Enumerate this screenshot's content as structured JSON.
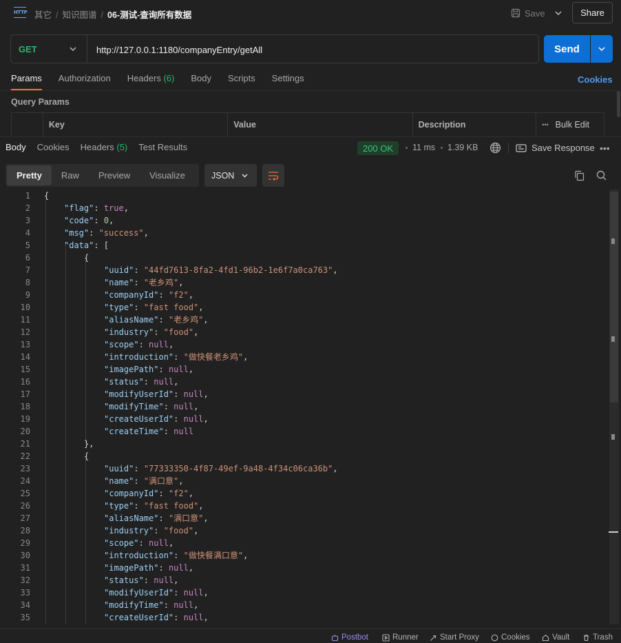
{
  "header": {
    "crumbs": [
      "其它",
      "知识图谱"
    ],
    "current": "06-测试-查询所有数据",
    "save_label": "Save",
    "share_label": "Share",
    "http_icon_label": "HTTP"
  },
  "request": {
    "method": "GET",
    "url": "http://127.0.0.1:1180/companyEntry/getAll",
    "send_label": "Send",
    "tabs": [
      {
        "label": "Params",
        "active": true
      },
      {
        "label": "Authorization"
      },
      {
        "label": "Headers",
        "count": "(6)"
      },
      {
        "label": "Body"
      },
      {
        "label": "Scripts"
      },
      {
        "label": "Settings"
      }
    ],
    "cookies_label": "Cookies",
    "query_params_title": "Query Params",
    "table_headers": [
      "Key",
      "Value",
      "Description"
    ],
    "bulk_edit_label": "Bulk Edit",
    "more_glyph": "•••"
  },
  "response": {
    "tabs": [
      {
        "label": "Body",
        "active": true
      },
      {
        "label": "Cookies"
      },
      {
        "label": "Headers",
        "count": "(5)"
      },
      {
        "label": "Test Results"
      }
    ],
    "status": "200 OK",
    "time": "11 ms",
    "size": "1.39 KB",
    "save_response_label": "Save Response",
    "more_glyph": "•••",
    "view_modes": [
      "Pretty",
      "Raw",
      "Preview",
      "Visualize"
    ],
    "active_view": "Pretty",
    "format": "JSON"
  },
  "code_lines": [
    {
      "n": "1",
      "i": 0,
      "t": [
        [
          "p",
          "{"
        ]
      ]
    },
    {
      "n": "2",
      "i": 1,
      "t": [
        [
          "k",
          "\"flag\""
        ],
        [
          "p",
          ": "
        ],
        [
          "b",
          "true"
        ],
        [
          "p",
          ","
        ]
      ]
    },
    {
      "n": "3",
      "i": 1,
      "t": [
        [
          "k",
          "\"code\""
        ],
        [
          "p",
          ": "
        ],
        [
          "n",
          "0"
        ],
        [
          "p",
          ","
        ]
      ]
    },
    {
      "n": "4",
      "i": 1,
      "t": [
        [
          "k",
          "\"msg\""
        ],
        [
          "p",
          ": "
        ],
        [
          "s",
          "\"success\""
        ],
        [
          "p",
          ","
        ]
      ]
    },
    {
      "n": "5",
      "i": 1,
      "t": [
        [
          "k",
          "\"data\""
        ],
        [
          "p",
          ": ["
        ]
      ]
    },
    {
      "n": "6",
      "i": 2,
      "t": [
        [
          "p",
          "{"
        ]
      ]
    },
    {
      "n": "7",
      "i": 3,
      "t": [
        [
          "k",
          "\"uuid\""
        ],
        [
          "p",
          ": "
        ],
        [
          "s",
          "\"44fd7613-8fa2-4fd1-96b2-1e6f7a0ca763\""
        ],
        [
          "p",
          ","
        ]
      ]
    },
    {
      "n": "8",
      "i": 3,
      "t": [
        [
          "k",
          "\"name\""
        ],
        [
          "p",
          ": "
        ],
        [
          "s",
          "\"老乡鸡\""
        ],
        [
          "p",
          ","
        ]
      ]
    },
    {
      "n": "9",
      "i": 3,
      "t": [
        [
          "k",
          "\"companyId\""
        ],
        [
          "p",
          ": "
        ],
        [
          "s",
          "\"f2\""
        ],
        [
          "p",
          ","
        ]
      ]
    },
    {
      "n": "10",
      "i": 3,
      "t": [
        [
          "k",
          "\"type\""
        ],
        [
          "p",
          ": "
        ],
        [
          "s",
          "\"fast food\""
        ],
        [
          "p",
          ","
        ]
      ]
    },
    {
      "n": "11",
      "i": 3,
      "t": [
        [
          "k",
          "\"aliasName\""
        ],
        [
          "p",
          ": "
        ],
        [
          "s",
          "\"老乡鸡\""
        ],
        [
          "p",
          ","
        ]
      ]
    },
    {
      "n": "12",
      "i": 3,
      "t": [
        [
          "k",
          "\"industry\""
        ],
        [
          "p",
          ": "
        ],
        [
          "s",
          "\"food\""
        ],
        [
          "p",
          ","
        ]
      ]
    },
    {
      "n": "13",
      "i": 3,
      "t": [
        [
          "k",
          "\"scope\""
        ],
        [
          "p",
          ": "
        ],
        [
          "nl",
          "null"
        ],
        [
          "p",
          ","
        ]
      ]
    },
    {
      "n": "14",
      "i": 3,
      "t": [
        [
          "k",
          "\"introduction\""
        ],
        [
          "p",
          ": "
        ],
        [
          "s",
          "\"做快餐老乡鸡\""
        ],
        [
          "p",
          ","
        ]
      ]
    },
    {
      "n": "15",
      "i": 3,
      "t": [
        [
          "k",
          "\"imagePath\""
        ],
        [
          "p",
          ": "
        ],
        [
          "nl",
          "null"
        ],
        [
          "p",
          ","
        ]
      ]
    },
    {
      "n": "16",
      "i": 3,
      "t": [
        [
          "k",
          "\"status\""
        ],
        [
          "p",
          ": "
        ],
        [
          "nl",
          "null"
        ],
        [
          "p",
          ","
        ]
      ]
    },
    {
      "n": "17",
      "i": 3,
      "t": [
        [
          "k",
          "\"modifyUserId\""
        ],
        [
          "p",
          ": "
        ],
        [
          "nl",
          "null"
        ],
        [
          "p",
          ","
        ]
      ]
    },
    {
      "n": "18",
      "i": 3,
      "t": [
        [
          "k",
          "\"modifyTime\""
        ],
        [
          "p",
          ": "
        ],
        [
          "nl",
          "null"
        ],
        [
          "p",
          ","
        ]
      ]
    },
    {
      "n": "19",
      "i": 3,
      "t": [
        [
          "k",
          "\"createUserId\""
        ],
        [
          "p",
          ": "
        ],
        [
          "nl",
          "null"
        ],
        [
          "p",
          ","
        ]
      ]
    },
    {
      "n": "20",
      "i": 3,
      "t": [
        [
          "k",
          "\"createTime\""
        ],
        [
          "p",
          ": "
        ],
        [
          "nl",
          "null"
        ]
      ]
    },
    {
      "n": "21",
      "i": 2,
      "t": [
        [
          "p",
          "},"
        ]
      ]
    },
    {
      "n": "22",
      "i": 2,
      "t": [
        [
          "p",
          "{"
        ]
      ]
    },
    {
      "n": "23",
      "i": 3,
      "t": [
        [
          "k",
          "\"uuid\""
        ],
        [
          "p",
          ": "
        ],
        [
          "s",
          "\"77333350-4f87-49ef-9a48-4f34c06ca36b\""
        ],
        [
          "p",
          ","
        ]
      ]
    },
    {
      "n": "24",
      "i": 3,
      "t": [
        [
          "k",
          "\"name\""
        ],
        [
          "p",
          ": "
        ],
        [
          "s",
          "\"满口意\""
        ],
        [
          "p",
          ","
        ]
      ]
    },
    {
      "n": "25",
      "i": 3,
      "t": [
        [
          "k",
          "\"companyId\""
        ],
        [
          "p",
          ": "
        ],
        [
          "s",
          "\"f2\""
        ],
        [
          "p",
          ","
        ]
      ]
    },
    {
      "n": "26",
      "i": 3,
      "t": [
        [
          "k",
          "\"type\""
        ],
        [
          "p",
          ": "
        ],
        [
          "s",
          "\"fast food\""
        ],
        [
          "p",
          ","
        ]
      ]
    },
    {
      "n": "27",
      "i": 3,
      "t": [
        [
          "k",
          "\"aliasName\""
        ],
        [
          "p",
          ": "
        ],
        [
          "s",
          "\"满口意\""
        ],
        [
          "p",
          ","
        ]
      ]
    },
    {
      "n": "28",
      "i": 3,
      "t": [
        [
          "k",
          "\"industry\""
        ],
        [
          "p",
          ": "
        ],
        [
          "s",
          "\"food\""
        ],
        [
          "p",
          ","
        ]
      ]
    },
    {
      "n": "29",
      "i": 3,
      "t": [
        [
          "k",
          "\"scope\""
        ],
        [
          "p",
          ": "
        ],
        [
          "nl",
          "null"
        ],
        [
          "p",
          ","
        ]
      ]
    },
    {
      "n": "30",
      "i": 3,
      "t": [
        [
          "k",
          "\"introduction\""
        ],
        [
          "p",
          ": "
        ],
        [
          "s",
          "\"做快餐满口意\""
        ],
        [
          "p",
          ","
        ]
      ]
    },
    {
      "n": "31",
      "i": 3,
      "t": [
        [
          "k",
          "\"imagePath\""
        ],
        [
          "p",
          ": "
        ],
        [
          "nl",
          "null"
        ],
        [
          "p",
          ","
        ]
      ]
    },
    {
      "n": "32",
      "i": 3,
      "t": [
        [
          "k",
          "\"status\""
        ],
        [
          "p",
          ": "
        ],
        [
          "nl",
          "null"
        ],
        [
          "p",
          ","
        ]
      ]
    },
    {
      "n": "33",
      "i": 3,
      "t": [
        [
          "k",
          "\"modifyUserId\""
        ],
        [
          "p",
          ": "
        ],
        [
          "nl",
          "null"
        ],
        [
          "p",
          ","
        ]
      ]
    },
    {
      "n": "34",
      "i": 3,
      "t": [
        [
          "k",
          "\"modifyTime\""
        ],
        [
          "p",
          ": "
        ],
        [
          "nl",
          "null"
        ],
        [
          "p",
          ","
        ]
      ]
    },
    {
      "n": "35",
      "i": 3,
      "t": [
        [
          "k",
          "\"createUserId\""
        ],
        [
          "p",
          ": "
        ],
        [
          "nl",
          "null"
        ],
        [
          "p",
          ","
        ]
      ]
    }
  ],
  "statusbar": {
    "items": [
      "Postbot",
      "Runner",
      "Start Proxy",
      "Cookies",
      "Vault",
      "Trash"
    ]
  },
  "colors": {
    "accent": "#ff6c37",
    "send": "#0d6fd6",
    "method_get": "#2fb36b",
    "status_ok": "#3cc47c"
  }
}
